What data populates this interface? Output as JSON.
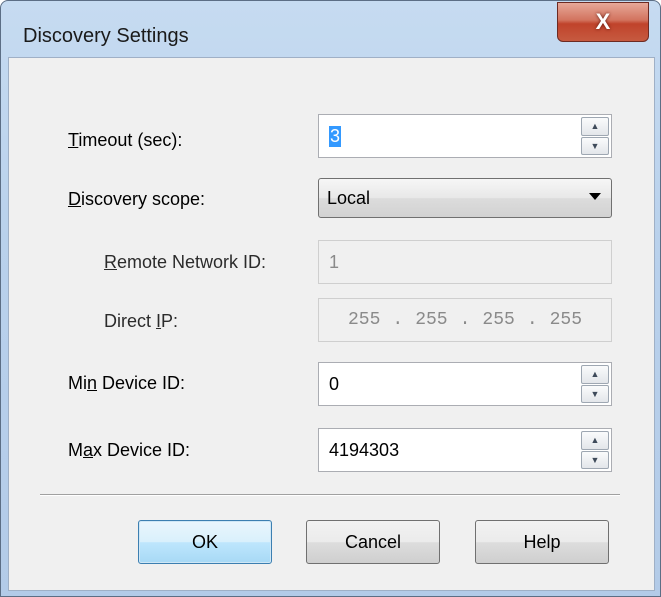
{
  "window": {
    "title": "Discovery Settings",
    "close_label": "X"
  },
  "form": {
    "timeout": {
      "label_pre": "",
      "label_mnemonic": "T",
      "label_post": "imeout (sec):",
      "value": "3"
    },
    "scope": {
      "label_pre": "",
      "label_mnemonic": "D",
      "label_post": "iscovery scope:",
      "value": "Local"
    },
    "remote_network": {
      "label_pre": "",
      "label_mnemonic": "R",
      "label_post": "emote Network ID:",
      "value": "1"
    },
    "direct_ip": {
      "label_pre": "Direct ",
      "label_mnemonic": "I",
      "label_post": "P:",
      "octets": [
        "255",
        "255",
        "255",
        "255"
      ],
      "dot": "."
    },
    "min_device": {
      "label_pre": "Mi",
      "label_mnemonic": "n",
      "label_post": " Device ID:",
      "value": "0"
    },
    "max_device": {
      "label_pre": "M",
      "label_mnemonic": "a",
      "label_post": "x Device ID:",
      "value": "4194303"
    }
  },
  "buttons": {
    "ok": "OK",
    "cancel": "Cancel",
    "help": "Help"
  },
  "icons": {
    "spin_up": "▲",
    "spin_down": "▼"
  }
}
